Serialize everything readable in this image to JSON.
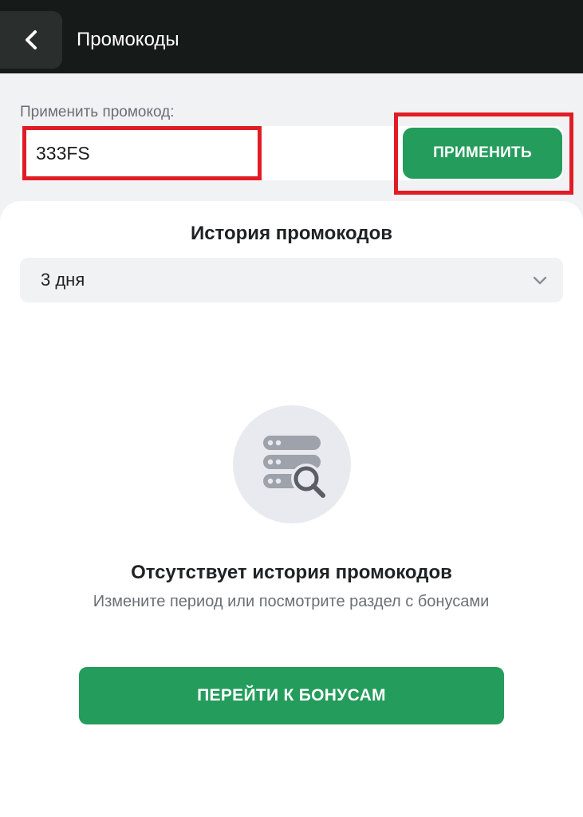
{
  "header": {
    "title": "Промокоды",
    "back_icon": "chevron-left-icon"
  },
  "promo": {
    "label": "Применить промокод:",
    "input_value": "333FS",
    "apply_label": "ПРИМЕНИТЬ"
  },
  "history": {
    "title": "История промокодов",
    "period_selected": "3 дня",
    "dropdown_icon": "chevron-down-icon"
  },
  "empty_state": {
    "icon": "database-search-icon",
    "title": "Отсутствует история промокодов",
    "description": "Измените период или посмотрите раздел с бонусами",
    "button_label": "ПЕРЕЙТИ К БОНУСАМ"
  },
  "colors": {
    "header_bg": "#161b19",
    "accent_green": "#249c5c",
    "highlight_red": "#e11c26",
    "page_bg": "#f1f2f4"
  }
}
